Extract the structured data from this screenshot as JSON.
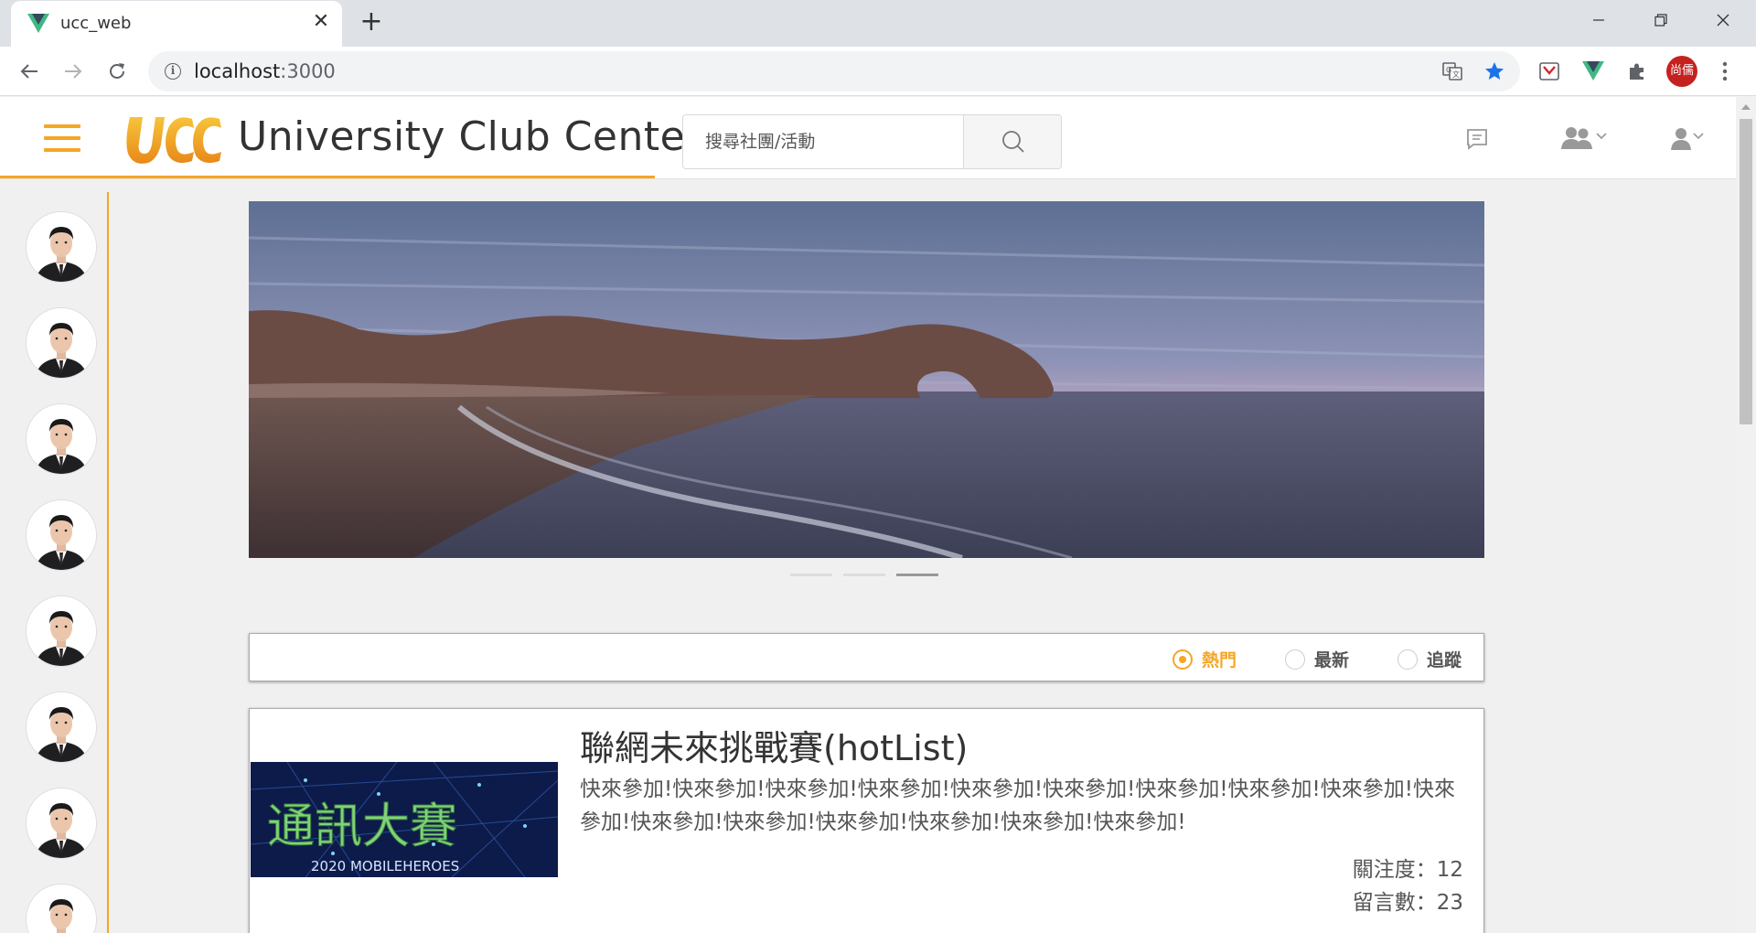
{
  "browser": {
    "tab_title": "ucc_web",
    "url_host": "localhost",
    "url_port": ":3000",
    "profile_initials": "尚儒"
  },
  "header": {
    "site_title": "University Club Center",
    "search_placeholder": "搜尋社團/活動"
  },
  "sidebar": {
    "avatars": [
      "avatar-1",
      "avatar-2",
      "avatar-3",
      "avatar-4",
      "avatar-5",
      "avatar-6",
      "avatar-7",
      "avatar-8"
    ]
  },
  "carousel": {
    "slide_count": 3,
    "active_index": 2
  },
  "filter": {
    "options": [
      {
        "label": "熱門",
        "checked": true
      },
      {
        "label": "最新",
        "checked": false
      },
      {
        "label": "追蹤",
        "checked": false
      }
    ]
  },
  "card": {
    "title": "聯網未來挑戰賽(hotList)",
    "description": "快來參加!快來參加!快來參加!快來參加!快來參加!快來參加!快來參加!快來參加!快來參加!快來參加!快來參加!快來參加!快來參加!快來參加!快來參加!快來參加!",
    "followers": "關注度：12",
    "comments": "留言數：23",
    "thumb_text": "通訊大賽",
    "thumb_subtext": "2020 MOBILEHEROES"
  },
  "colors": {
    "accent": "#f5a623",
    "browser_tab_bg": "#dee1e6",
    "vue_green": "#41b883"
  }
}
